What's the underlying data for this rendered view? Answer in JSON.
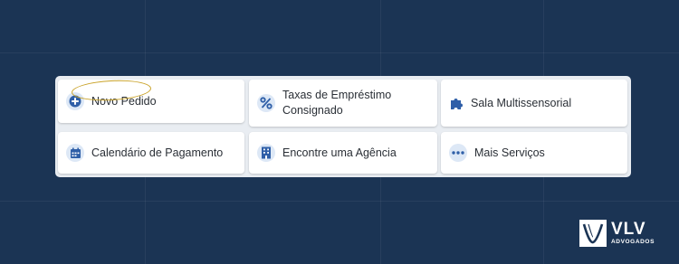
{
  "services": {
    "items": [
      {
        "label": "Novo Pedido",
        "icon": "plus-circle-icon"
      },
      {
        "label": "Taxas de Empréstimo\nConsignado",
        "icon": "percent-icon"
      },
      {
        "label": "Sala Multissensorial",
        "icon": "puzzle-icon"
      },
      {
        "label": "Calendário de Pagamento",
        "icon": "calendar-icon"
      },
      {
        "label": "Encontre uma Agência",
        "icon": "building-icon"
      },
      {
        "label": "Mais Serviços",
        "icon": "more-dots-icon"
      }
    ]
  },
  "logo": {
    "title": "VLV",
    "subtitle": "ADVOGADOS"
  },
  "colors": {
    "background": "#1b3454",
    "icon_blue": "#2f5fa8",
    "icon_bg": "#dde8f6",
    "highlight": "#c9a227"
  }
}
